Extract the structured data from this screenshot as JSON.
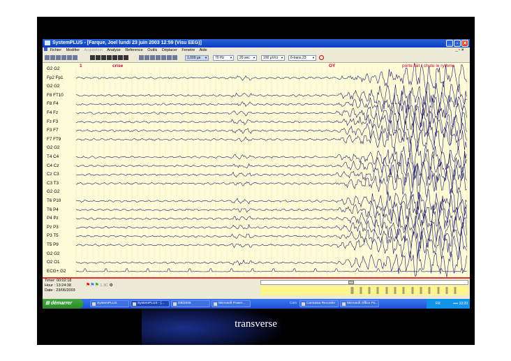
{
  "slide": {
    "caption": "transverse"
  },
  "window": {
    "title": "SystemPLUS - [Farque, Joel lundi 23 juin 2003 12:59 (Visu EEG)]"
  },
  "menu": {
    "items": [
      "Fichier",
      "Modifier",
      "Acquisition",
      "Analyse",
      "Reference",
      "Outils",
      "Déplacer",
      "Fenetre",
      "Aide"
    ],
    "right": "_ ▫ ✕"
  },
  "toolbar": {
    "combo1": "1,000 μs",
    "combo2": "70 Hz",
    "combo3": "20 sec",
    "combo4": "100 μV/cr",
    "combo5": "6-trans.23"
  },
  "eeg": {
    "channels": [
      "G2 G2",
      "Fp2 Fp1",
      "G2 G2",
      "F8 FT10",
      "F8 F4",
      "F4 Fz",
      "Fz F3",
      "F3 F7",
      "F7 FT9",
      "G2 G2",
      "T4 C4",
      "C4 Cz",
      "Cz C3",
      "C3 T3",
      "G2 G2",
      "T6 P10",
      "T6 P4",
      "P4 Pz",
      "Pz P3",
      "P3 T5",
      "T5 P9",
      "G2 G2",
      "O2 O1",
      "ECG+ G2"
    ],
    "markers": {
      "m1": "1",
      "m2": "crise",
      "m3": "OY",
      "m4": "porte fait : chute le rythme"
    }
  },
  "info": {
    "timer": "Timer: 00:02:18",
    "hour": "Hour   : 13:24:38",
    "date": "Date   : 23/06/2003",
    "scale": "1.3C"
  },
  "taskbar": {
    "start": "démarrer",
    "tasks": [
      "SystemPLUS",
      "SystemPLUS - [...",
      "DB/2005",
      "Microsoft Power...",
      "Camtasia Recorder",
      "Microsoft Office Po..."
    ],
    "cam": "Cam",
    "lang": "FR",
    "clock": "10:20"
  },
  "colors": {
    "trace": "#1c1c6e",
    "marker": "#c0003a",
    "eeg_bg": "#fdfbd8",
    "taskbar": "#2456d8"
  }
}
